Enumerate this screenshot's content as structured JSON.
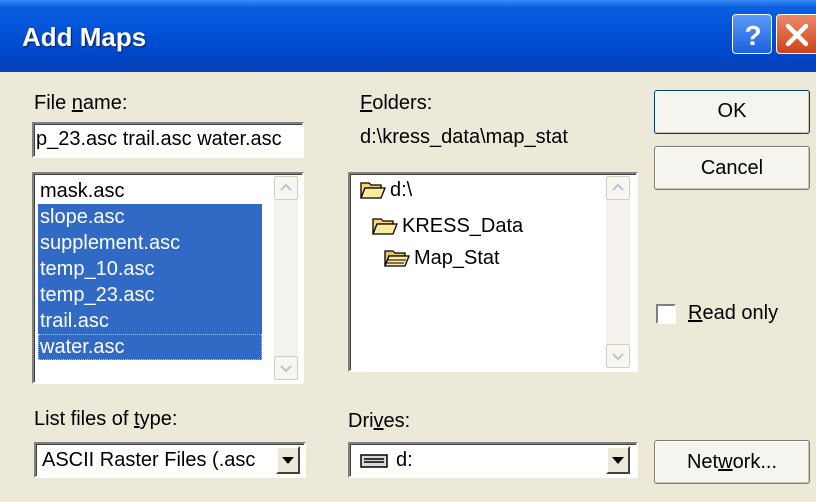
{
  "window": {
    "title": "Add Maps"
  },
  "file_name": {
    "label_pre": "File ",
    "label_u": "n",
    "label_post": "ame:",
    "value": "p_23.asc trail.asc water.asc",
    "list": [
      {
        "name": "mask.asc",
        "selected": false
      },
      {
        "name": "slope.asc",
        "selected": true
      },
      {
        "name": "supplement.asc",
        "selected": true
      },
      {
        "name": "temp_10.asc",
        "selected": true
      },
      {
        "name": "temp_23.asc",
        "selected": true
      },
      {
        "name": "trail.asc",
        "selected": true
      },
      {
        "name": "water.asc",
        "selected": true
      }
    ]
  },
  "folders": {
    "label_u": "F",
    "label_post": "olders:",
    "path": "d:\\kress_data\\map_stat",
    "tree": [
      "d:\\",
      "KRESS_Data",
      "Map_Stat"
    ]
  },
  "buttons": {
    "ok": "OK",
    "cancel": "Cancel",
    "network_pre": "Net",
    "network_u": "w",
    "network_post": "ork..."
  },
  "read_only": {
    "label_u": "R",
    "label_post": "ead only",
    "checked": false
  },
  "file_type": {
    "label_pre": "List files of ",
    "label_u": "t",
    "label_post": "ype:",
    "value": "ASCII Raster Files (.asc"
  },
  "drives": {
    "label_pre": "Dri",
    "label_u": "v",
    "label_post": "es:",
    "value": "d:"
  },
  "colors": {
    "selection": "#316ac5",
    "titlebar": "#0251d6",
    "dialog_bg": "#ece9d8"
  }
}
